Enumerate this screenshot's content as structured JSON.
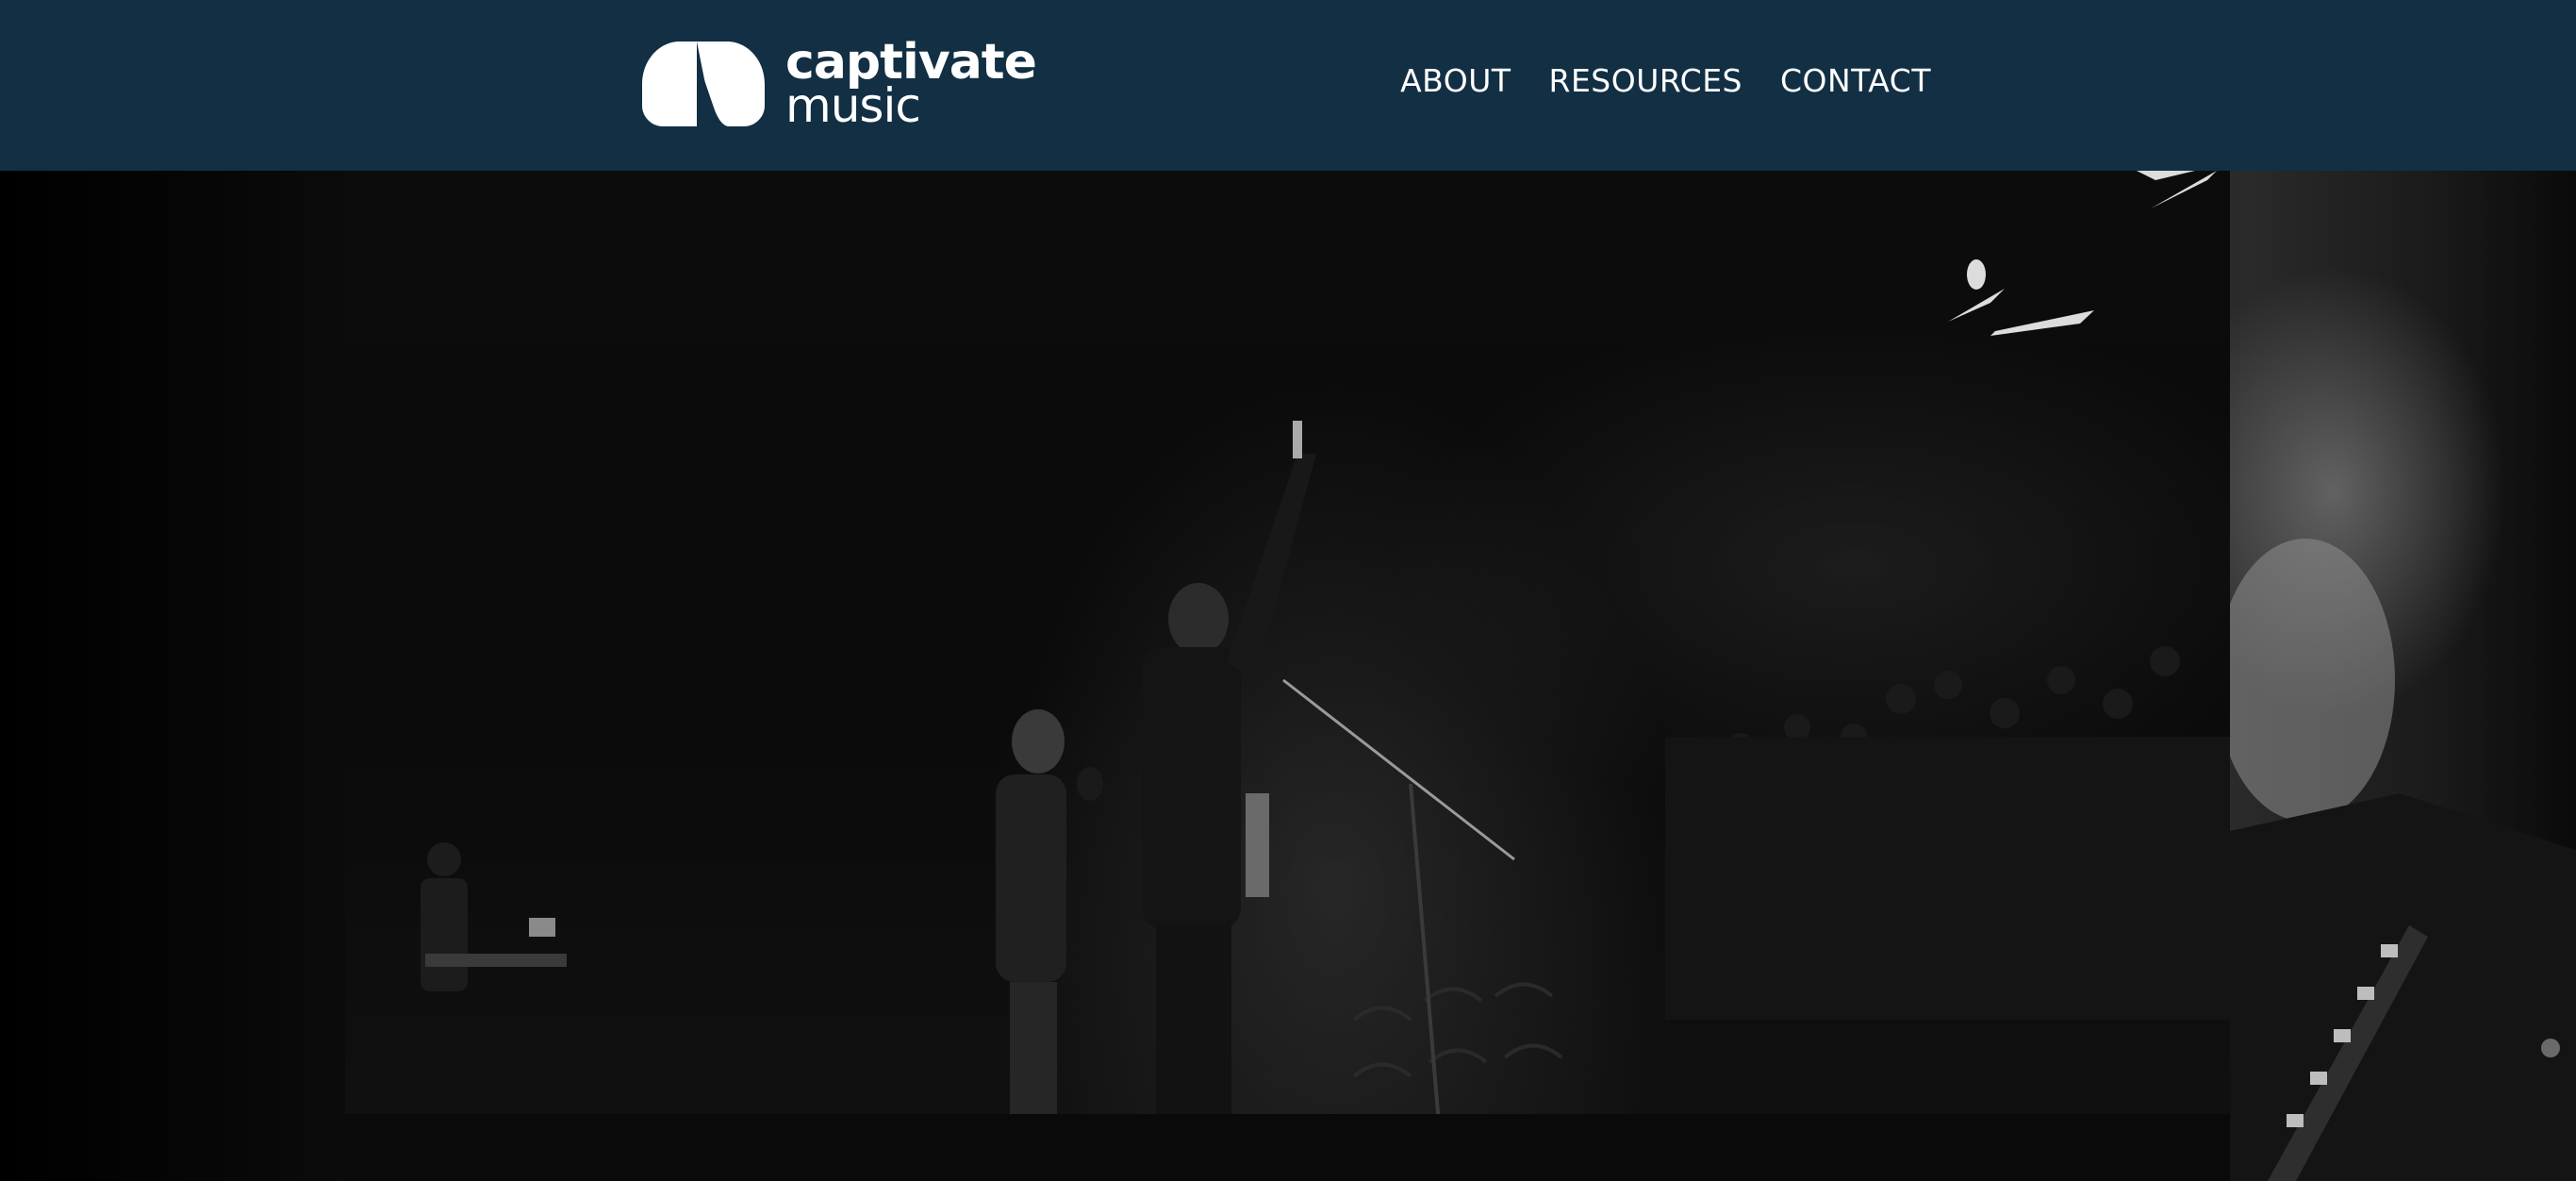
{
  "header": {
    "background": "#122f44",
    "logo": {
      "line1": "captivate",
      "line2": "music",
      "icon": "captivate-logo-mark"
    },
    "nav": [
      {
        "label": "ABOUT"
      },
      {
        "label": "RESOURCES"
      },
      {
        "label": "CONTACT"
      }
    ]
  },
  "hero": {
    "description_hidden": ""
  }
}
